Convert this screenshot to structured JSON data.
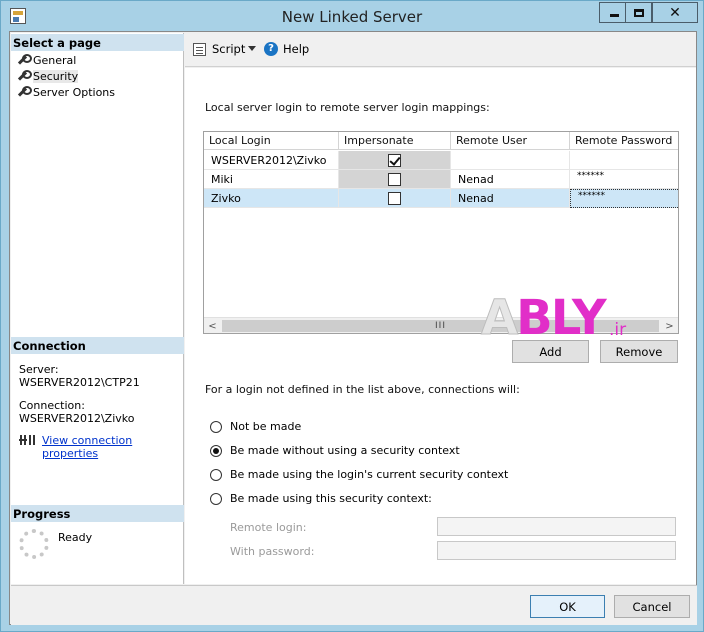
{
  "window": {
    "title": "New Linked Server"
  },
  "left_pane": {
    "select_page_header": "Select a page",
    "pages": [
      {
        "label": "General"
      },
      {
        "label": "Security"
      },
      {
        "label": "Server Options"
      }
    ],
    "selected_page": "Security",
    "connection_header": "Connection",
    "server_label": "Server:",
    "server_value": "WSERVER2012\\CTP21",
    "connection_label": "Connection:",
    "connection_value": "WSERVER2012\\Zivko",
    "view_connection_link": "View connection properties",
    "progress_header": "Progress",
    "progress_status": "Ready"
  },
  "toolbar": {
    "script_label": "Script",
    "help_label": "Help"
  },
  "security": {
    "mappings_label": "Local server login to remote server login mappings:",
    "columns": [
      "Local Login",
      "Impersonate",
      "Remote User",
      "Remote Password"
    ],
    "rows": [
      {
        "local_login": "WSERVER2012\\Zivko",
        "impersonate": true,
        "remote_user": "",
        "remote_password": ""
      },
      {
        "local_login": "Miki",
        "impersonate": false,
        "remote_user": "Nenad",
        "remote_password": "******"
      },
      {
        "local_login": "Zivko",
        "impersonate": false,
        "remote_user": "Nenad",
        "remote_password": "******"
      }
    ],
    "selected_row": 2,
    "scroll_thumb_grip": "III",
    "add_button": "Add",
    "remove_button": "Remove",
    "not_defined_label": "For a login not defined in the list above, connections will:",
    "options": [
      {
        "label": "Not be made",
        "selected": false
      },
      {
        "label": "Be made without using a security context",
        "selected": true
      },
      {
        "label": "Be made using the login's current security context",
        "selected": false
      },
      {
        "label": "Be made using this security context:",
        "selected": false
      }
    ],
    "remote_login_label": "Remote login:",
    "remote_login_value": "",
    "with_password_label": "With password:",
    "with_password_value": ""
  },
  "watermark": {
    "letter_a": "A",
    "text": "BLY",
    "suffix": ".ir"
  },
  "footer": {
    "ok_button": "OK",
    "cancel_button": "Cancel"
  }
}
